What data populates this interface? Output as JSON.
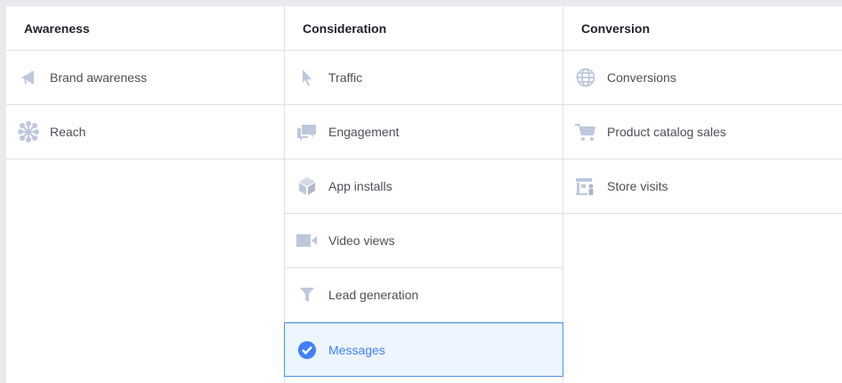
{
  "columns": [
    {
      "title": "Awareness",
      "items": [
        {
          "label": "Brand awareness",
          "icon": "megaphone-icon"
        },
        {
          "label": "Reach",
          "icon": "reach-icon"
        }
      ]
    },
    {
      "title": "Consideration",
      "items": [
        {
          "label": "Traffic",
          "icon": "cursor-icon"
        },
        {
          "label": "Engagement",
          "icon": "chat-bubbles-icon"
        },
        {
          "label": "App installs",
          "icon": "box-icon"
        },
        {
          "label": "Video views",
          "icon": "video-camera-icon"
        },
        {
          "label": "Lead generation",
          "icon": "funnel-icon"
        },
        {
          "label": "Messages",
          "icon": "check-circle-icon",
          "selected": true
        }
      ]
    },
    {
      "title": "Conversion",
      "items": [
        {
          "label": "Conversions",
          "icon": "globe-icon"
        },
        {
          "label": "Product catalog sales",
          "icon": "cart-icon"
        },
        {
          "label": "Store visits",
          "icon": "store-icon"
        }
      ]
    }
  ],
  "colors": {
    "icon": "#bec8dc",
    "selected_border": "#4a90e2",
    "selected_bg": "#edf5fe",
    "selected_text": "#4080ff"
  }
}
